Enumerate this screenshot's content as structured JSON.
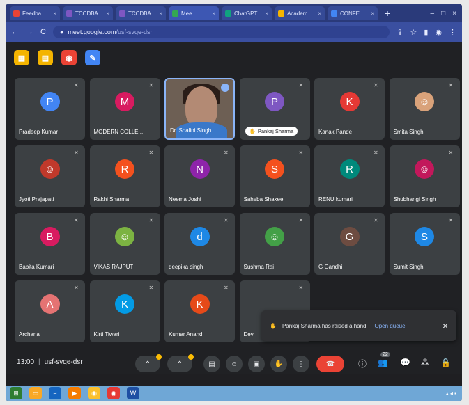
{
  "browser": {
    "tabs": [
      {
        "label": "Feedba",
        "color": "#ea4335"
      },
      {
        "label": "TCCDBA",
        "color": "#7e57c2"
      },
      {
        "label": "TCCDBA",
        "color": "#7e57c2"
      },
      {
        "label": "Mee",
        "color": "#34a853",
        "active": true
      },
      {
        "label": "ChatGPT",
        "color": "#10a37f"
      },
      {
        "label": "Academ",
        "color": "#f4b400"
      },
      {
        "label": "CONFE",
        "color": "#4285f4"
      }
    ],
    "new_tab": "+",
    "url_main": "meet.google.com",
    "url_path": "/usf-svqe-dsr"
  },
  "meet": {
    "app_icons": [
      {
        "name": "notes-icon",
        "color": "#f4b400",
        "glyph": "▦"
      },
      {
        "name": "docs-icon",
        "color": "#f4b400",
        "glyph": "▤"
      },
      {
        "name": "record-icon",
        "color": "#ea4335",
        "glyph": "◉"
      },
      {
        "name": "edit-icon",
        "color": "#4285f4",
        "glyph": "✎"
      }
    ],
    "participants": [
      {
        "name": "Pradeep Kumar",
        "initial": "P",
        "color": "#4285f4"
      },
      {
        "name": "MODERN COLLE...",
        "initial": "M",
        "color": "#d81b60"
      },
      {
        "name": "Dr. Shalini Singh",
        "initial": "",
        "color": "",
        "video": true
      },
      {
        "name": "Pankaj Sharma",
        "initial": "P",
        "color": "#7e57c2",
        "hand": true
      },
      {
        "name": "Kanak Pande",
        "initial": "K",
        "color": "#e53935"
      },
      {
        "name": "Smita Singh",
        "initial": "",
        "color": "#d9a27a",
        "photo": true
      },
      {
        "name": "Jyoti Prajapati",
        "initial": "",
        "color": "#c0392b",
        "photo": true
      },
      {
        "name": "Rakhi Sharma",
        "initial": "R",
        "color": "#f4511e"
      },
      {
        "name": "Neema Joshi",
        "initial": "N",
        "color": "#8e24aa"
      },
      {
        "name": "Saheba Shakeel",
        "initial": "S",
        "color": "#f4511e"
      },
      {
        "name": "RENU kumari",
        "initial": "R",
        "color": "#00897b"
      },
      {
        "name": "Shubhangi Singh",
        "initial": "",
        "color": "#c2185b",
        "photo": true
      },
      {
        "name": "Babita Kumari",
        "initial": "B",
        "color": "#d81b60"
      },
      {
        "name": "VIKAS RAJPUT",
        "initial": "",
        "color": "#7cb342",
        "photo": true
      },
      {
        "name": "deepika singh",
        "initial": "d",
        "color": "#1e88e5"
      },
      {
        "name": "Sushma Rai",
        "initial": "",
        "color": "#43a047",
        "photo": true
      },
      {
        "name": "G Gandhi",
        "initial": "G",
        "color": "#6d4c41"
      },
      {
        "name": "Sumit Singh",
        "initial": "S",
        "color": "#1e88e5"
      },
      {
        "name": "Archana",
        "initial": "A",
        "color": "#e57373"
      },
      {
        "name": "Kirti Tiwari",
        "initial": "K",
        "color": "#039be5"
      },
      {
        "name": "Kumar Anand",
        "initial": "K",
        "color": "#e64a19"
      },
      {
        "name": "Dev",
        "initial": "",
        "color": ""
      }
    ],
    "toast": {
      "message": "Pankaj Sharma has raised a hand",
      "action": "Open queue"
    },
    "time": "13:00",
    "meeting_code": "usf-svqe-dsr",
    "participants_badge": "22"
  },
  "colors": {
    "leave_red": "#ea4335",
    "accent_blue": "#8ab4f8",
    "taskbar": "#6fa7d6"
  }
}
